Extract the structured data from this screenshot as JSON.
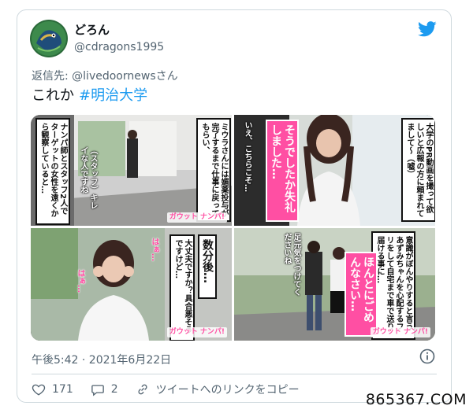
{
  "user": {
    "display_name": "どろん",
    "handle": "@cdragons1995",
    "avatar_icon": "dragon-avatar-icon"
  },
  "reply": {
    "prefix": "返信先: ",
    "target": "@livedoornews",
    "suffix": "さん"
  },
  "tweet": {
    "text": "これか",
    "hashtag": "#明治大学"
  },
  "media": {
    "panels": [
      {
        "caption_a": "ミウラさんには媚薬投与が完了するまで仕事に戻ってもらい、",
        "caption_b": "ナンパ師とスタッフ2人でターゲットの女性を遠くから観察していると…",
        "caption_c": "（スタッフ）キレイな人ですね",
        "logo": "ガウット ナンパ!"
      },
      {
        "caption_a": "大学のPR動画を撮って欲しいと広報の方に頼まれてまして〜（嘘）",
        "caption_b": "そうでしたか失礼しました…",
        "caption_c": "いえ、こちらこそ…",
        "logo": "ガウット ナンパ!"
      },
      {
        "caption_a": "数分後…",
        "caption_b": "大丈夫ですか？具合悪そうですけど…",
        "caption_c": "はぁ…",
        "caption_d": "はぁ…",
        "logo": "ガウット ナンパ!"
      },
      {
        "caption_a": "意識がぼんやりすると言うあずみちゃんを心配するフリをして自宅まで車で送り届ける事に…",
        "caption_b": "ほんとにごめんなさい…",
        "caption_c": "足元気をつけてくださいね",
        "logo": "ガウット ナンパ!"
      }
    ]
  },
  "meta": {
    "timestamp": "午後5:42 · 2021年6月22日"
  },
  "actions": {
    "like_count": "171",
    "reply_count": "2",
    "copy_link_label": "ツイートへのリンクをコピー"
  },
  "watermark": "865367.COM",
  "colors": {
    "accent": "#1d9bf0",
    "muted": "#536471",
    "border": "#cfd9de",
    "caption_pink": "#ff4fa3"
  }
}
